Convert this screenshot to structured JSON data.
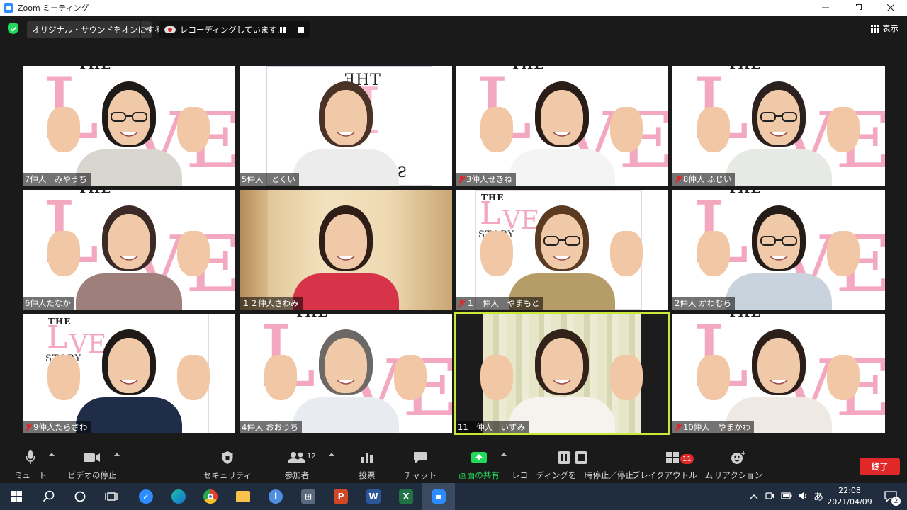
{
  "window": {
    "title": "Zoom ミーティング",
    "min_icon": "minimize-icon",
    "max_icon": "maximize-icon",
    "close_icon": "close-icon"
  },
  "topbar": {
    "audio_label": "オリジナル・サウンドをオンにする",
    "recording_label": "レコーディングしています...",
    "view_label": "表示"
  },
  "participants": [
    {
      "name": "7仲人　みやうち",
      "muted": false,
      "background": "love",
      "shirt": "#d9d6d0",
      "hair": "#1e1a18",
      "glasses": true,
      "hands": true
    },
    {
      "name": "5仲人　とくい",
      "muted": false,
      "background": "theste",
      "shirt": "#ececec",
      "hair": "#4a3226",
      "glasses": false,
      "hands": false
    },
    {
      "name": "3仲人せきね",
      "muted": true,
      "background": "love",
      "shirt": "#f4f4f4",
      "hair": "#2a1c16",
      "glasses": false,
      "hands": true
    },
    {
      "name": "8仲人 ふじい",
      "muted": true,
      "background": "love",
      "shirt": "#e7e9e4",
      "hair": "#2b2220",
      "glasses": true,
      "hands": true
    },
    {
      "name": "6仲人たなか",
      "muted": false,
      "background": "love",
      "shirt": "#9e7f7c",
      "hair": "#3b2a25",
      "glasses": false,
      "hands": true
    },
    {
      "name": "１２仲人さわみ",
      "muted": false,
      "background": "room",
      "shirt": "#d7344a",
      "hair": "#2e1e17",
      "glasses": false,
      "hands": false
    },
    {
      "name": "１　仲人　やまもと",
      "muted": true,
      "background": "lovestory",
      "shirt": "#b69d67",
      "hair": "#5b3a22",
      "glasses": true,
      "hands": true
    },
    {
      "name": "2仲人 かわむら",
      "muted": false,
      "background": "love",
      "shirt": "#c8d3dd",
      "hair": "#231c19",
      "glasses": true,
      "hands": true
    },
    {
      "name": "9仲人たらさわ",
      "muted": true,
      "background": "lovestory",
      "shirt": "#1f2d48",
      "hair": "#1f1a18",
      "glasses": false,
      "hands": true
    },
    {
      "name": "4仲人 おおうち",
      "muted": false,
      "background": "love",
      "shirt": "#e8ebf0",
      "hair": "#6c6866",
      "glasses": false,
      "hands": true
    },
    {
      "name": "11　仲人　いずみ",
      "muted": false,
      "background": "curtain",
      "shirt": "#f6f3ef",
      "hair": "#332219",
      "glasses": false,
      "hands": true,
      "active": true
    },
    {
      "name": "10仲人　やまかわ",
      "muted": true,
      "background": "love",
      "shirt": "#efe9e4",
      "hair": "#2c1f19",
      "glasses": false,
      "hands": true
    }
  ],
  "background_text": {
    "the": "THE",
    "l": "L",
    "ve": "VE",
    "story": "STORY"
  },
  "toolbar": {
    "mute_label": "ミュート",
    "video_label": "ビデオの停止",
    "security_label": "セキュリティ",
    "participants_label": "参加者",
    "participants_count": "12",
    "poll_label": "投票",
    "chat_label": "チャット",
    "share_label": "画面の共有",
    "recording_label": "レコーディングを一時停止／停止",
    "breakout_label": "ブレイクアウトルーム",
    "breakout_badge": "11",
    "reactions_label": "リアクション",
    "end_label": "終了"
  },
  "taskbar": {
    "ime": "あ",
    "time": "22:08",
    "date": "2021/04/09",
    "notification_count": "2",
    "apps": [
      "start-icon",
      "search-icon",
      "cortana-icon",
      "task-view-icon",
      "app-icon",
      "edge-icon",
      "chrome-icon",
      "explorer-icon",
      "info-icon",
      "store-icon",
      "powerpoint-icon",
      "word-icon",
      "excel-icon",
      "zoom-icon"
    ]
  },
  "colors": {
    "accent_green": "#23d959",
    "end_red": "#e02828",
    "active_border": "#c9e83a",
    "love_pink": "#f3a8bf"
  }
}
